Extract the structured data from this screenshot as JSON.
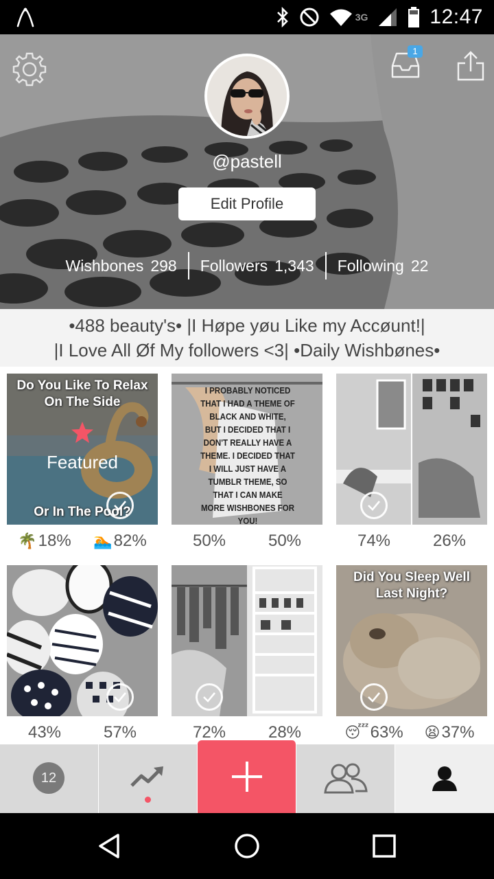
{
  "status_bar": {
    "time": "12:47",
    "network_label": "3G",
    "icons": [
      "wishbone-logo-icon",
      "bluetooth-icon",
      "do-not-disturb-icon",
      "wifi-icon",
      "signal-icon",
      "battery-icon"
    ]
  },
  "header": {
    "username": "@pastell",
    "edit_profile_label": "Edit Profile",
    "inbox_badge": "1",
    "stats": {
      "wishbones_label": "Wishbones",
      "wishbones_value": "298",
      "followers_label": "Followers",
      "followers_value": "1,343",
      "following_label": "Following",
      "following_value": "22"
    }
  },
  "bio": {
    "line1": "•488 beauty's• |I Høpe yøu Like my Accøunt!|",
    "line2": "|I Love All Øf My followers <3| •Daily Wishbønes•"
  },
  "posts": [
    {
      "caption_top": "Do You Like To Relax On The Side",
      "caption_bottom": "Or In The Pool?",
      "featured_label": "Featured",
      "left_pct": "18%",
      "right_pct": "82%",
      "left_emoji": "🌴",
      "right_emoji": "🏊",
      "answered": true
    },
    {
      "text_image": "I PROBABLY NOTICED THAT I HAD A THEME OF BLACK AND WHITE, BUT I DECIDED THAT I DON'T REALLY HAVE A THEME. I DECIDED THAT I WILL JUST HAVE A TUMBLR THEME, SO THAT I CAN MAKE MORE WISHBONES FOR YOU!",
      "left_pct": "50%",
      "right_pct": "50%",
      "answered": false
    },
    {
      "left_pct": "74%",
      "right_pct": "26%",
      "answered": true
    },
    {
      "left_pct": "43%",
      "right_pct": "57%",
      "answered": true
    },
    {
      "left_pct": "72%",
      "right_pct": "28%",
      "answered": true
    },
    {
      "caption_top": "Did You Sleep Well Last Night?",
      "left_pct": "63%",
      "right_pct": "37%",
      "left_emoji": "😴",
      "right_emoji": "😫",
      "answered": true
    }
  ],
  "tab_bar": {
    "notification_count": "12",
    "tabs": [
      "notifications-tab",
      "trending-tab",
      "create-tab",
      "friends-tab",
      "profile-tab"
    ]
  },
  "colors": {
    "accent": "#f45566",
    "badge": "#49a7e6"
  }
}
